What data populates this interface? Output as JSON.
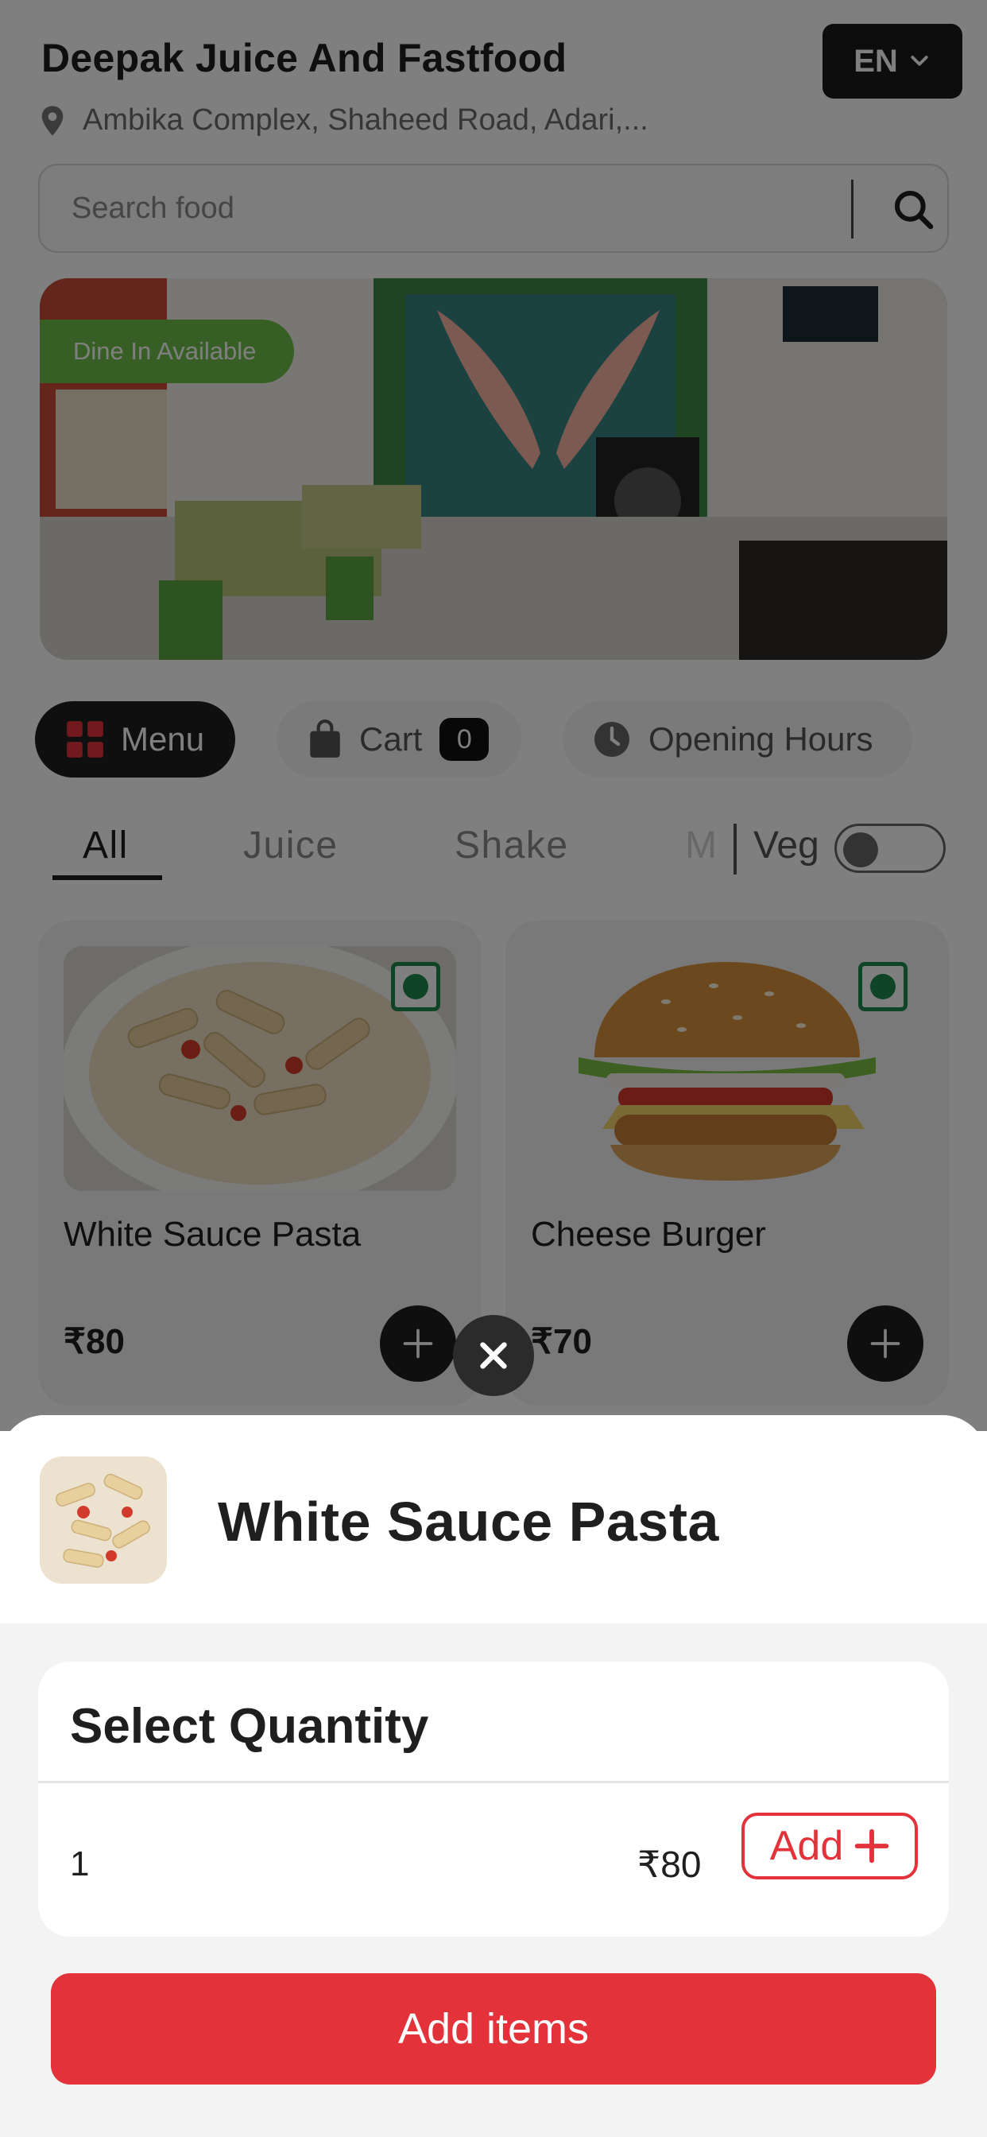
{
  "header": {
    "restaurant_name": "Deepak Juice And Fastfood",
    "address": "Ambika Complex, Shaheed Road, Adari,...",
    "language": "EN"
  },
  "search": {
    "placeholder": "Search food"
  },
  "banner": {
    "badge": "Dine In Available"
  },
  "nav": {
    "menu_label": "Menu",
    "cart_label": "Cart",
    "cart_count": "0",
    "hours_label": "Opening Hours"
  },
  "categories": {
    "tabs": [
      "All",
      "Juice",
      "Shake",
      "M"
    ],
    "veg_label": "Veg"
  },
  "items": [
    {
      "name": "White Sauce Pasta",
      "price": "₹80"
    },
    {
      "name": "Cheese Burger",
      "price": "₹70"
    }
  ],
  "sheet": {
    "item_name": "White Sauce Pasta",
    "section_title": "Select Quantity",
    "quantity": "1",
    "price": "₹80",
    "add_label": "Add",
    "submit_label": "Add items"
  },
  "colors": {
    "accent_red": "#e3323a",
    "veg_green": "#1f8a4c",
    "dark": "#1f1f1f",
    "badge_green": "#6fbf4a"
  }
}
